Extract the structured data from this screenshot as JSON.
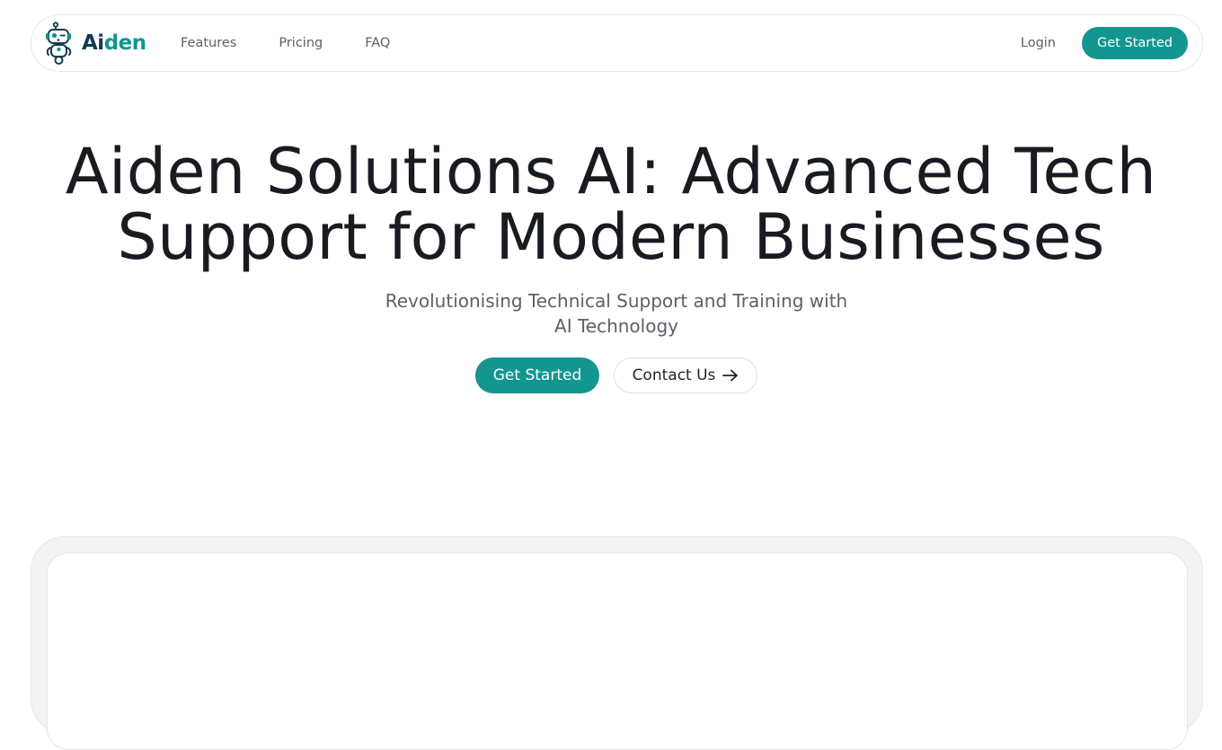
{
  "brand": {
    "logo_icon": "robot-icon",
    "name_part1": "Ai",
    "name_part2": "den",
    "colors": {
      "primary": "#13968f",
      "navy": "#133a52"
    }
  },
  "nav": {
    "links": [
      {
        "label": "Features"
      },
      {
        "label": "Pricing"
      },
      {
        "label": "FAQ"
      }
    ],
    "login_label": "Login",
    "cta_label": "Get Started"
  },
  "hero": {
    "title_line1": "Aiden Solutions AI: Advanced Tech",
    "title_line2": "Support for Modern Businesses",
    "subtitle": "Revolutionising Technical Support and Training with AI Technology",
    "primary_button": "Get Started",
    "secondary_button": "Contact Us",
    "secondary_icon": "arrow-right-icon"
  }
}
